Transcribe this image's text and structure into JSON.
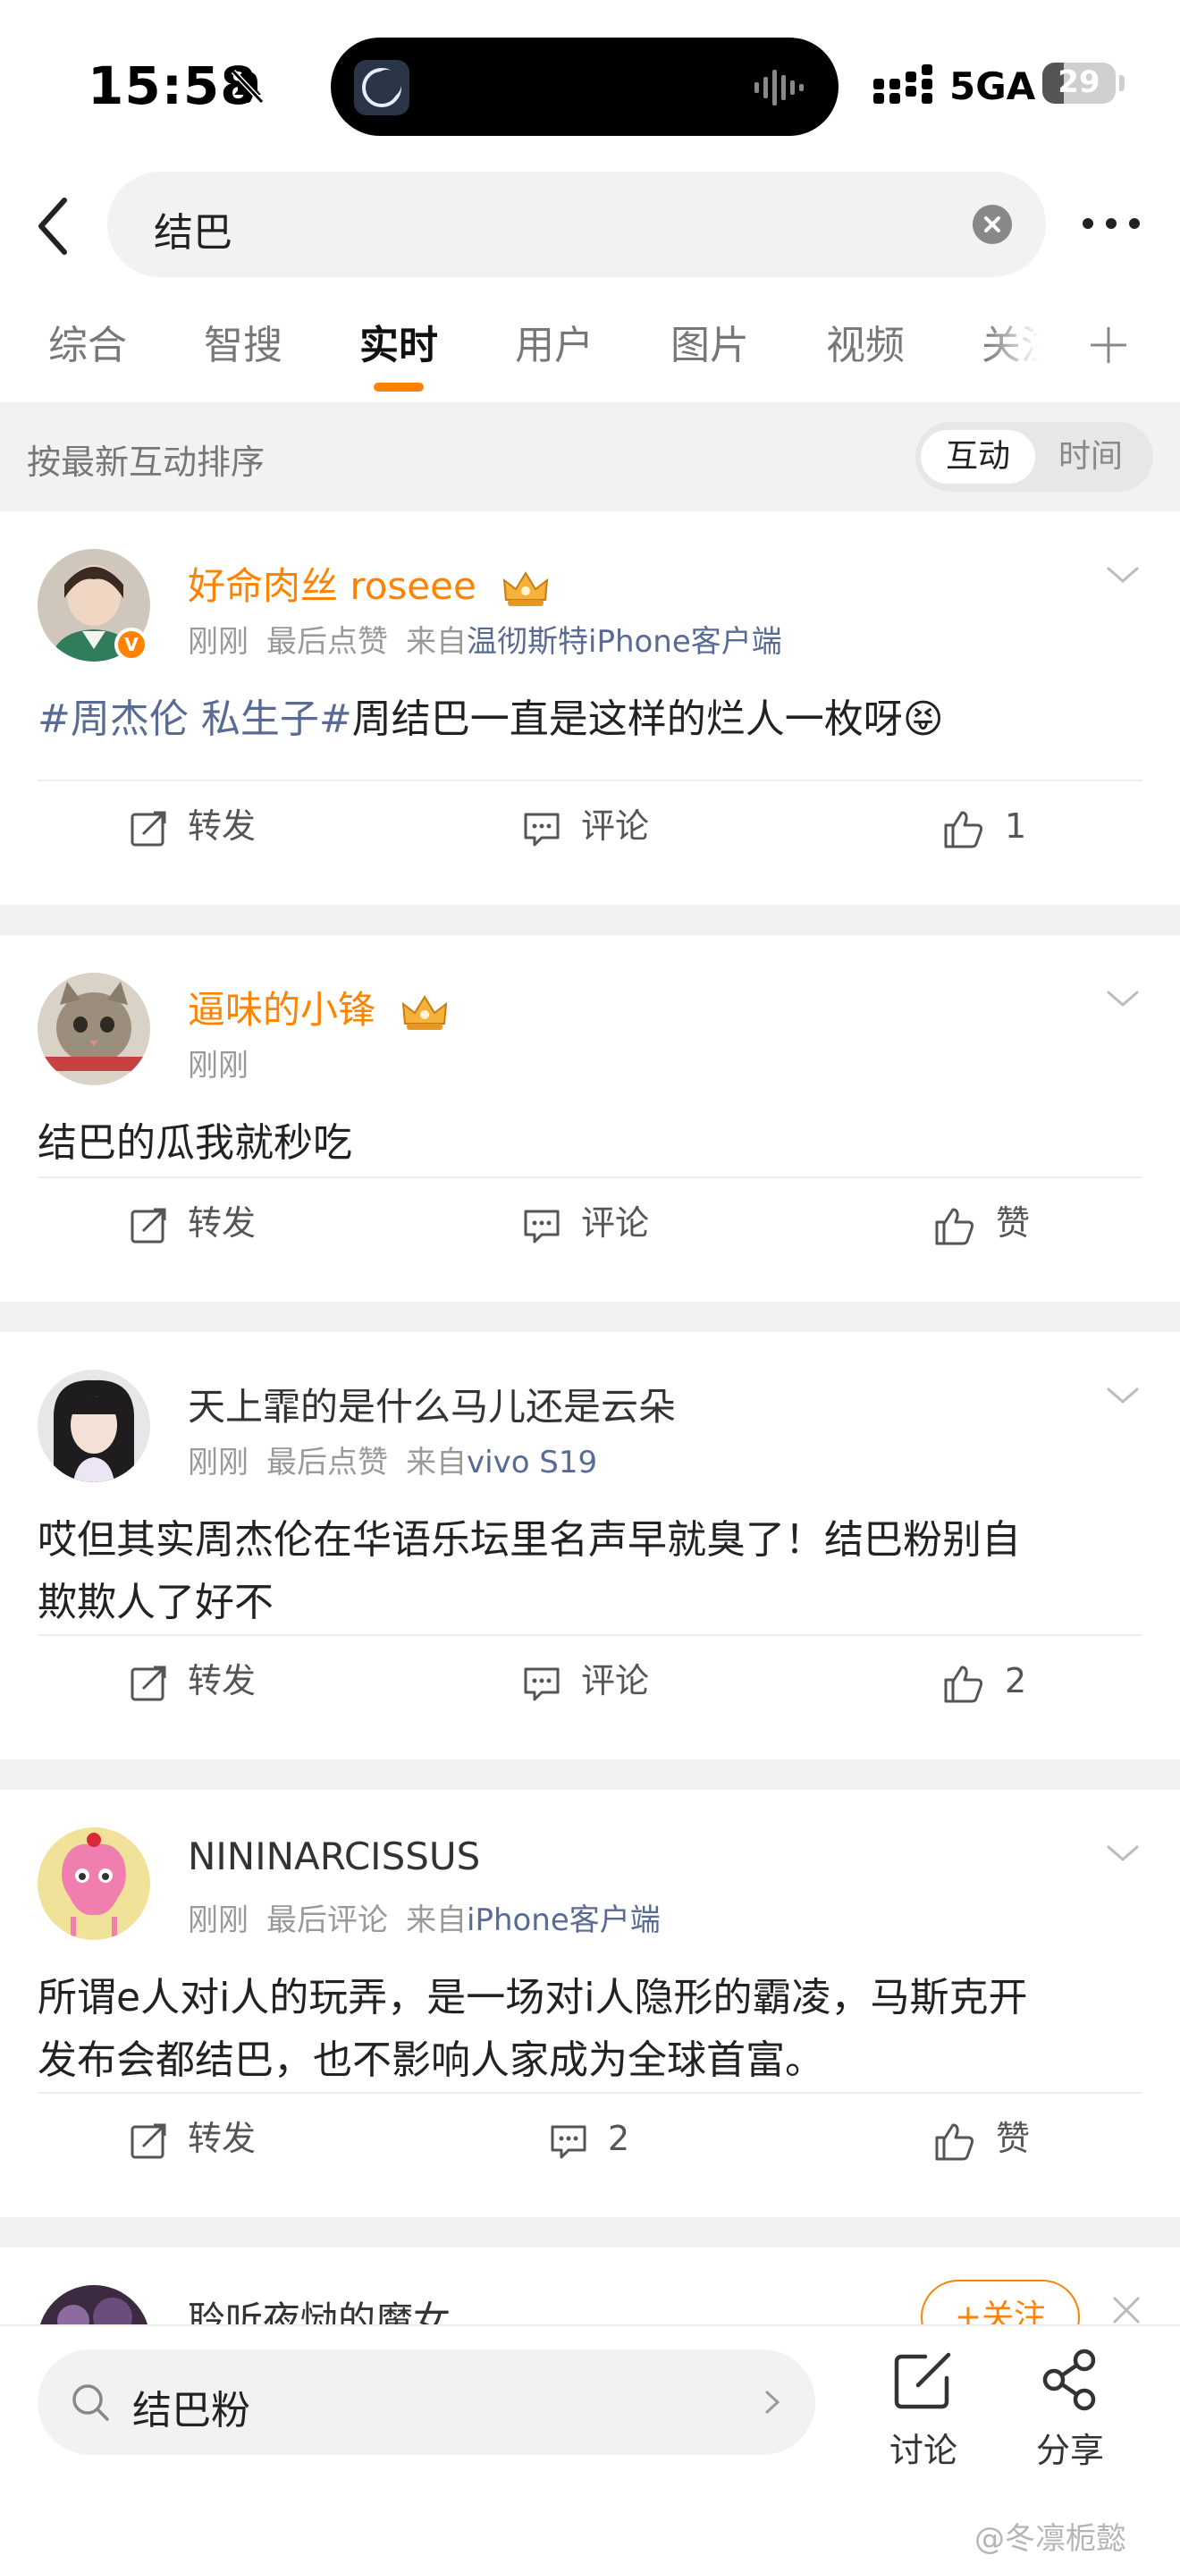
{
  "status_bar": {
    "time": "15:58",
    "network": "5GA",
    "battery_level": "29",
    "battery_percent": 29
  },
  "header": {
    "search_query": "结巴",
    "back_icon": "chevron-left-icon",
    "clear_icon": "clear-circle-icon",
    "more_icon": "more-dots-icon"
  },
  "tabs": [
    {
      "label": "综合",
      "active": false
    },
    {
      "label": "智搜",
      "active": false
    },
    {
      "label": "实时",
      "active": true
    },
    {
      "label": "用户",
      "active": false
    },
    {
      "label": "图片",
      "active": false
    },
    {
      "label": "视频",
      "active": false
    },
    {
      "label": "关注",
      "active": false
    }
  ],
  "sort_bar": {
    "label": "按最新互动排序",
    "options": [
      "互动",
      "时间"
    ],
    "selected": "互动"
  },
  "posts": [
    {
      "username": "好命肉丝 roseee",
      "vip": true,
      "verified": true,
      "meta_time": "刚刚",
      "meta_activity": "最后点赞",
      "meta_source_prefix": "来自",
      "meta_source": "温彻斯特iPhone客户端",
      "tag": "#周杰伦 私生子#",
      "content": "周结巴一直是这样的烂人一枚呀",
      "emoji": "😝",
      "repost_label": "转发",
      "comment_label": "评论",
      "like_label": "1"
    },
    {
      "username": "逼味的小锋",
      "vip": true,
      "verified": false,
      "meta_time": "刚刚",
      "content": "结巴的瓜我就秒吃",
      "repost_label": "转发",
      "comment_label": "评论",
      "like_label": "赞"
    },
    {
      "username": "天上霏的是什么马儿还是云朵",
      "vip": false,
      "verified": false,
      "meta_time": "刚刚",
      "meta_activity": "最后点赞",
      "meta_source_prefix": "来自",
      "meta_source": "vivo S19",
      "content_line1": "哎但其实周杰伦在华语乐坛里名声早就臭了！结巴粉别自",
      "content_line2": "欺欺人了好不",
      "repost_label": "转发",
      "comment_label": "评论",
      "like_label": "2"
    },
    {
      "username": "NININARCISSUS",
      "vip": false,
      "verified": false,
      "meta_time": "刚刚",
      "meta_activity": "最后评论",
      "meta_source_prefix": "来自",
      "meta_source": "iPhone客户端",
      "content_line1": "所谓e人对i人的玩弄，是一场对i人隐形的霸凌，马斯克开",
      "content_line2": "发布会都结巴，也不影响人家成为全球首富。",
      "repost_label": "转发",
      "comment_label": "2",
      "like_label": "赞"
    },
    {
      "username": "聆听夜恸的魔女",
      "follow_label": "+关注"
    }
  ],
  "bottom_bar": {
    "search_text": "结巴粉",
    "discuss_label": "讨论",
    "share_label": "分享",
    "watermark": "@冬凛栀懿"
  },
  "colors": {
    "accent": "#ff8200",
    "link": "#576b95",
    "separator": "#f2f2f2"
  }
}
